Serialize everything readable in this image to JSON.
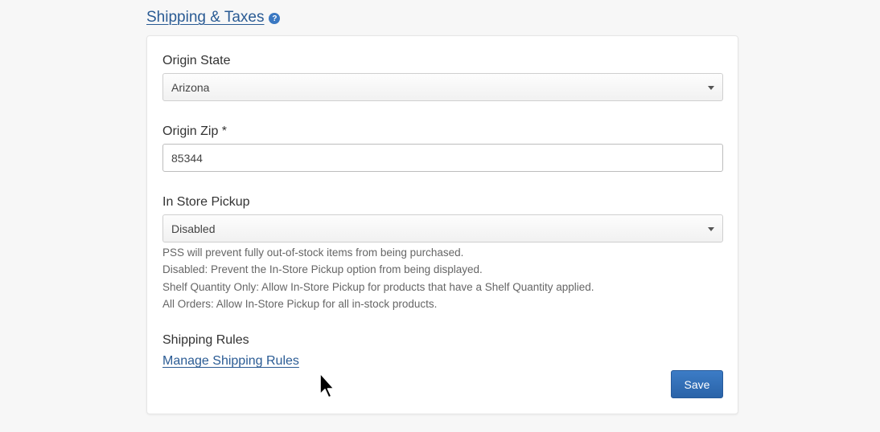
{
  "section": {
    "title": "Shipping & Taxes",
    "help_icon": "question-circle-icon"
  },
  "form": {
    "origin_state": {
      "label": "Origin State",
      "value": "Arizona"
    },
    "origin_zip": {
      "label": "Origin Zip *",
      "value": "85344"
    },
    "in_store_pickup": {
      "label": "In Store Pickup",
      "value": "Disabled",
      "help": [
        "PSS will prevent fully out-of-stock items from being purchased.",
        "Disabled: Prevent the In-Store Pickup option from being displayed.",
        "Shelf Quantity Only: Allow In-Store Pickup for products that have a Shelf Quantity applied.",
        "All Orders: Allow In-Store Pickup for all in-stock products."
      ]
    },
    "shipping_rules": {
      "label": "Shipping Rules",
      "link": "Manage Shipping Rules"
    },
    "save_label": "Save"
  },
  "colors": {
    "link": "#2a5b94",
    "primary_button": "#2f6db5"
  }
}
